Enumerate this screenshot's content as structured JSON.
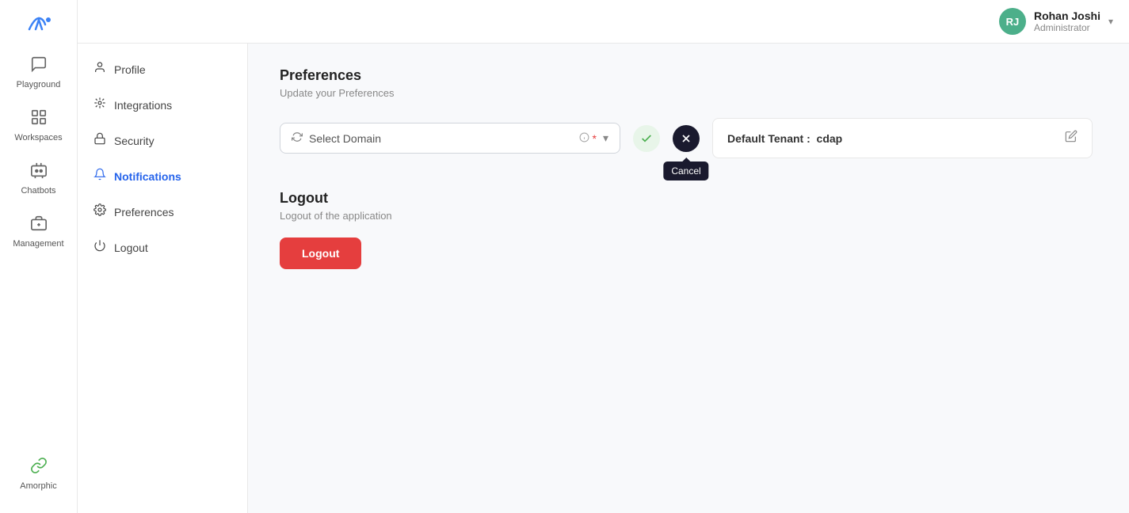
{
  "app": {
    "logo_text": "~ai",
    "brand": "Amorphic"
  },
  "header": {
    "user_initials": "RJ",
    "user_name": "Rohan Joshi",
    "user_role": "Administrator",
    "chevron": "▾"
  },
  "sidebar": {
    "items": [
      {
        "id": "playground",
        "label": "Playground",
        "icon": "💬"
      },
      {
        "id": "workspaces",
        "label": "Workspaces",
        "icon": "⊞"
      },
      {
        "id": "chatbots",
        "label": "Chatbots",
        "icon": "🤖"
      },
      {
        "id": "management",
        "label": "Management",
        "icon": "💼"
      }
    ],
    "bottom": {
      "label": "Amorphic",
      "icon": "🔗"
    }
  },
  "settings_menu": {
    "items": [
      {
        "id": "profile",
        "label": "Profile",
        "icon": "person"
      },
      {
        "id": "integrations",
        "label": "Integrations",
        "icon": "integrations"
      },
      {
        "id": "security",
        "label": "Security",
        "icon": "security"
      },
      {
        "id": "notifications",
        "label": "Notifications",
        "icon": "bell",
        "active": true
      },
      {
        "id": "preferences",
        "label": "Preferences",
        "icon": "gear"
      },
      {
        "id": "logout",
        "label": "Logout",
        "icon": "power"
      }
    ]
  },
  "preferences": {
    "section_title": "Preferences",
    "section_subtitle": "Update your Preferences",
    "select_domain_placeholder": "Select Domain",
    "select_domain_required": "*",
    "default_tenant_label": "Default Tenant :",
    "default_tenant_value": "cdap",
    "check_tooltip": "",
    "cancel_tooltip": "Cancel"
  },
  "logout_section": {
    "title": "Logout",
    "subtitle": "Logout of the application",
    "button_label": "Logout"
  }
}
